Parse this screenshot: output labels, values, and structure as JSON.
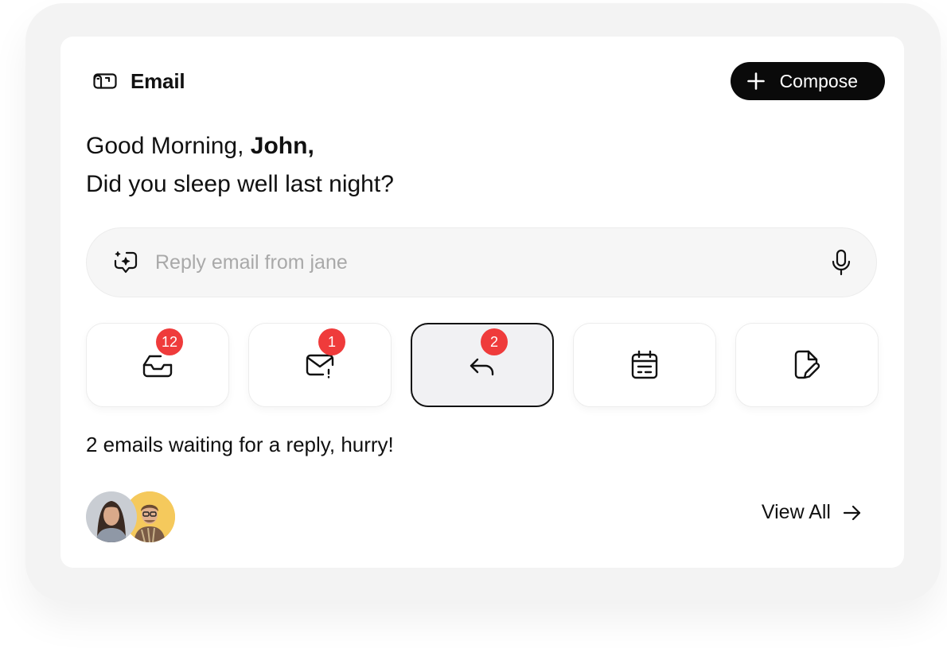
{
  "header": {
    "title": "Email",
    "brand_icon": "mailbox-icon",
    "compose_label": "Compose",
    "compose_icon": "plus-icon"
  },
  "greeting": {
    "prefix": "Good Morning, ",
    "name": "John,",
    "question": "Did you sleep well last night?"
  },
  "search": {
    "placeholder": "Reply email from jane",
    "leading_icon": "ai-sparkle-chat-icon",
    "trailing_icon": "microphone-icon"
  },
  "tiles": [
    {
      "name": "inbox",
      "icon": "inbox-tray-icon",
      "badge": "12",
      "active": false
    },
    {
      "name": "important",
      "icon": "mail-alert-icon",
      "badge": "1",
      "active": false
    },
    {
      "name": "reply",
      "icon": "reply-arrow-icon",
      "badge": "2",
      "active": true
    },
    {
      "name": "calendar",
      "icon": "calendar-icon",
      "badge": "",
      "active": false
    },
    {
      "name": "drafts",
      "icon": "file-edit-icon",
      "badge": "",
      "active": false
    }
  ],
  "status": "2 emails waiting for a reply, hurry!",
  "footer": {
    "view_all": "View All",
    "arrow_icon": "arrow-right-icon"
  },
  "colors": {
    "badge": "#ef3b3b",
    "primary": "#0a0a0a",
    "avatar2_bg": "#f5c95c"
  }
}
